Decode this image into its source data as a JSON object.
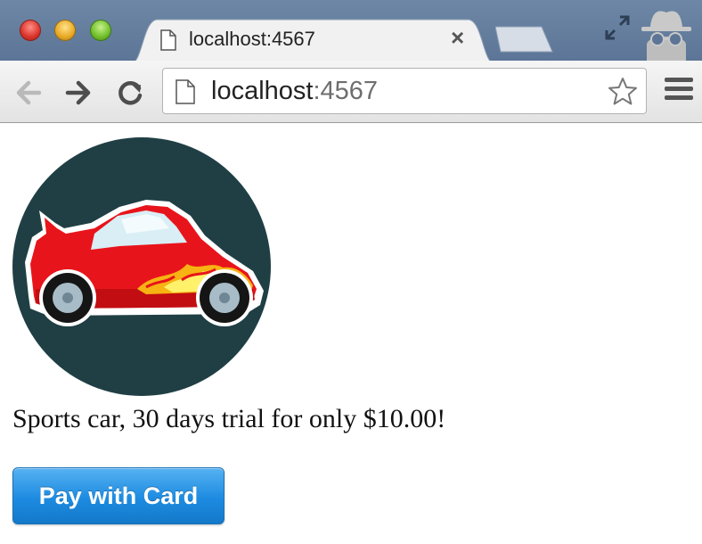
{
  "browser": {
    "tab": {
      "title": "localhost:4567",
      "close_label": "×"
    },
    "address_bar": {
      "host": "localhost",
      "port": ":4567"
    }
  },
  "page": {
    "product_description": "Sports car, 30 days trial for only $10.00!",
    "pay_button_label": "Pay with Card"
  },
  "icons": {
    "back": "arrow-left-icon",
    "forward": "arrow-right-icon",
    "reload": "reload-icon",
    "bookmark": "star-icon",
    "menu": "hamburger-menu-icon",
    "fullscreen": "fullscreen-icon",
    "incognito": "incognito-icon"
  },
  "colors": {
    "pay_button": "#1d8be1",
    "product_circle": "#1f3f44",
    "car_body": "#e8141b"
  }
}
